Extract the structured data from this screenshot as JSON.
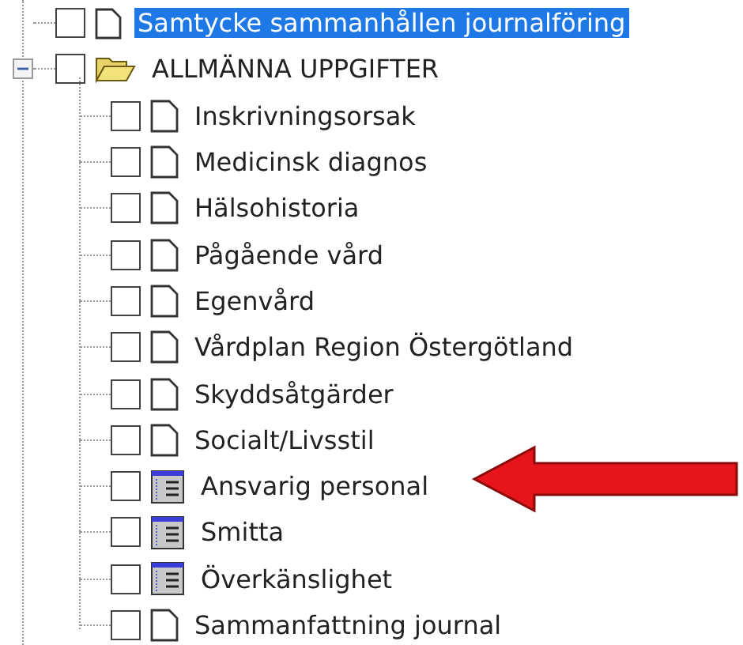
{
  "tree": [
    {
      "label": "Samtycke sammanhållen journalföring",
      "kind": "document",
      "checked": false,
      "selected": true
    },
    {
      "label": "ALLMÄNNA UPPGIFTER",
      "kind": "folder",
      "checked": false,
      "selected": false,
      "expanded": true,
      "children": [
        {
          "label": "Inskrivningsorsak",
          "kind": "document",
          "checked": false,
          "selected": false
        },
        {
          "label": "Medicinsk diagnos",
          "kind": "document",
          "checked": false,
          "selected": false
        },
        {
          "label": "Hälsohistoria",
          "kind": "document",
          "checked": false,
          "selected": false
        },
        {
          "label": "Pågående vård",
          "kind": "document",
          "checked": false,
          "selected": false
        },
        {
          "label": "Egenvård",
          "kind": "document",
          "checked": false,
          "selected": false
        },
        {
          "label": "Vårdplan Region Östergötland",
          "kind": "document",
          "checked": false,
          "selected": false
        },
        {
          "label": "Skyddsåtgärder",
          "kind": "document",
          "checked": false,
          "selected": false
        },
        {
          "label": "Socialt/Livsstil",
          "kind": "document",
          "checked": false,
          "selected": false
        },
        {
          "label": "Ansvarig personal",
          "kind": "form",
          "checked": false,
          "selected": false
        },
        {
          "label": "Smitta",
          "kind": "form",
          "checked": false,
          "selected": false
        },
        {
          "label": "Överkänslighet",
          "kind": "form",
          "checked": false,
          "selected": false
        },
        {
          "label": "Sammanfattning journal",
          "kind": "document",
          "checked": false,
          "selected": false
        }
      ]
    }
  ]
}
